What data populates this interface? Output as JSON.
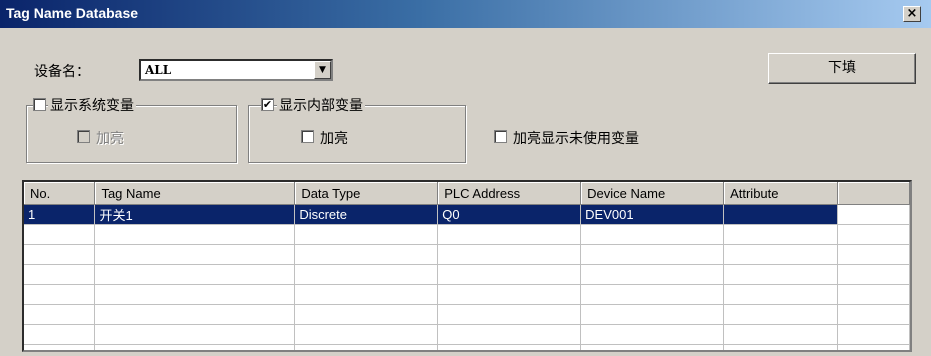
{
  "window": {
    "title": "Tag Name Database",
    "close_glyph": "×"
  },
  "device": {
    "label": "设备名：",
    "selected": "ALL",
    "arrow": "▼"
  },
  "fill_button": "下填",
  "group_system": {
    "label": "显示系统变量",
    "checked": false,
    "sub_label": "加亮",
    "sub_checked": false,
    "sub_enabled": false
  },
  "group_internal": {
    "label": "显示内部变量",
    "checked": true,
    "sub_label": "加亮",
    "sub_checked": false
  },
  "highlight_unused": {
    "label": "加亮显示未使用变量",
    "checked": false
  },
  "table": {
    "headers": [
      "No.",
      "Tag Name",
      "Data Type",
      "PLC Address",
      "Device Name",
      "Attribute",
      ""
    ],
    "rows": [
      [
        "1",
        "开关1",
        "Discrete",
        "Q0",
        "DEV001",
        ""
      ]
    ]
  },
  "colors": {
    "selection": "#0a246a",
    "face": "#d4d0c8"
  }
}
